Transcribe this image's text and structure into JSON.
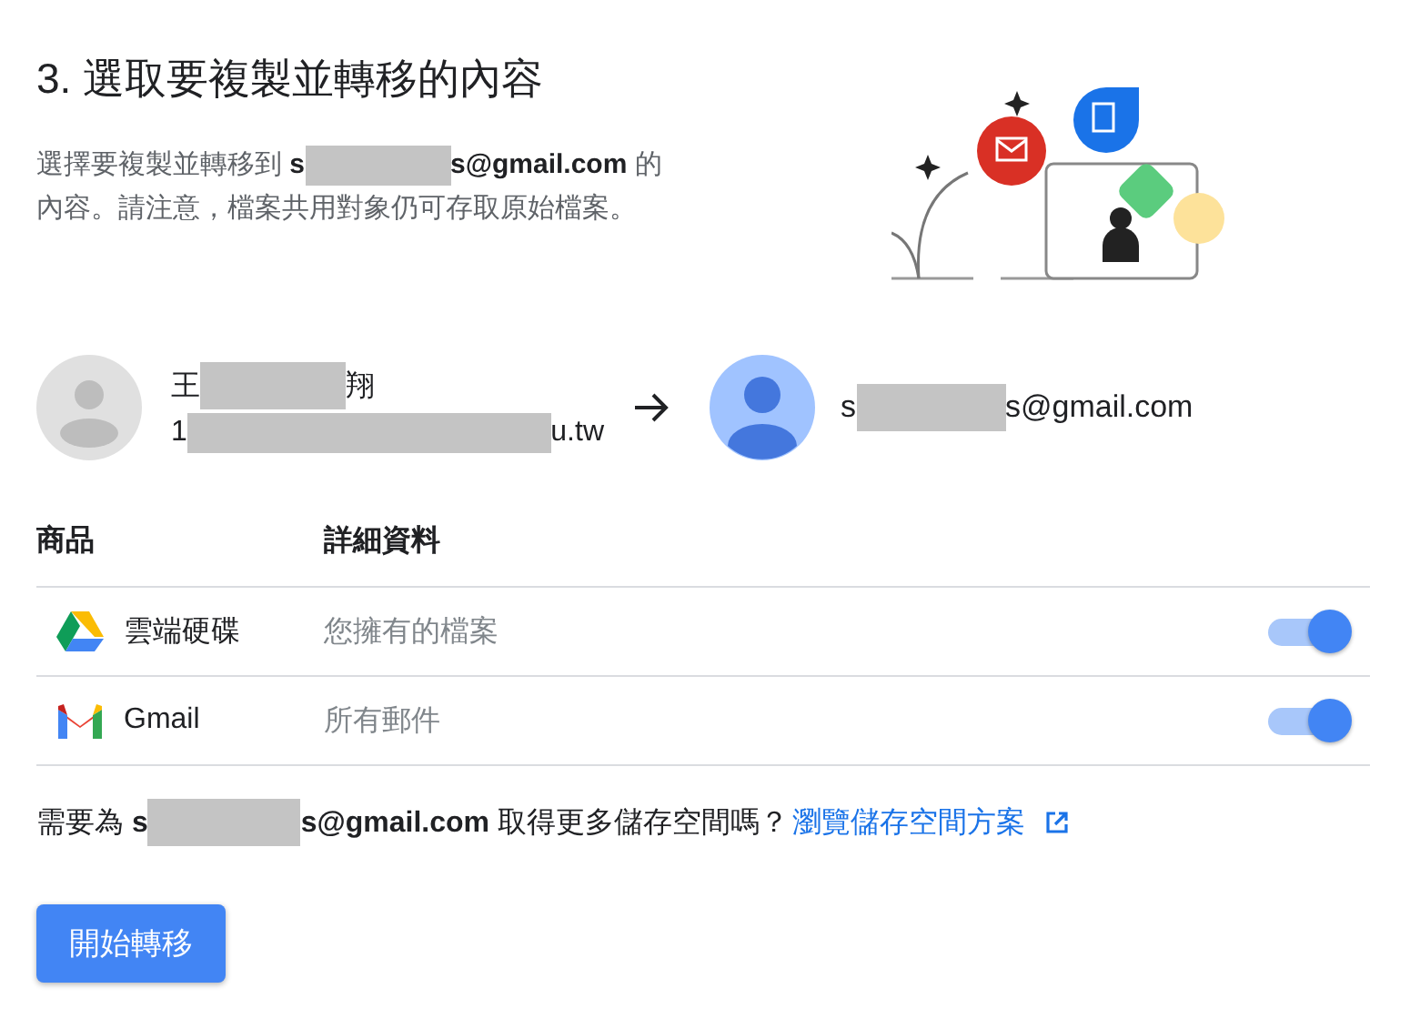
{
  "title": "3. 選取要複製並轉移的內容",
  "description": {
    "before": "選擇要複製並轉移到 **s**",
    "after": "**s@gmail.com** 的",
    "continuation": "內容。請注意，檔案共用對象仍可存取原始檔案。"
  },
  "source_account": {
    "name_start": "王",
    "name_end": "翔",
    "email_start": "1",
    "email_end": "u.tw"
  },
  "target_account": {
    "email_start": "s",
    "email_end": "s@gmail.com"
  },
  "table": {
    "columns": [
      "商品",
      "詳細資料"
    ],
    "rows": [
      {
        "kind": "drive",
        "product": "雲端硬碟",
        "detail": "您擁有的檔案",
        "on": true
      },
      {
        "kind": "gmail",
        "product": "Gmail",
        "detail": "所有郵件",
        "on": true
      }
    ]
  },
  "storage_prompt": {
    "before": "需要為 **s**",
    "after": "**s@gmail.com** 取得更多儲存空間嗎？",
    "link": "瀏覽儲存空間方案"
  },
  "start_button": "開始轉移"
}
